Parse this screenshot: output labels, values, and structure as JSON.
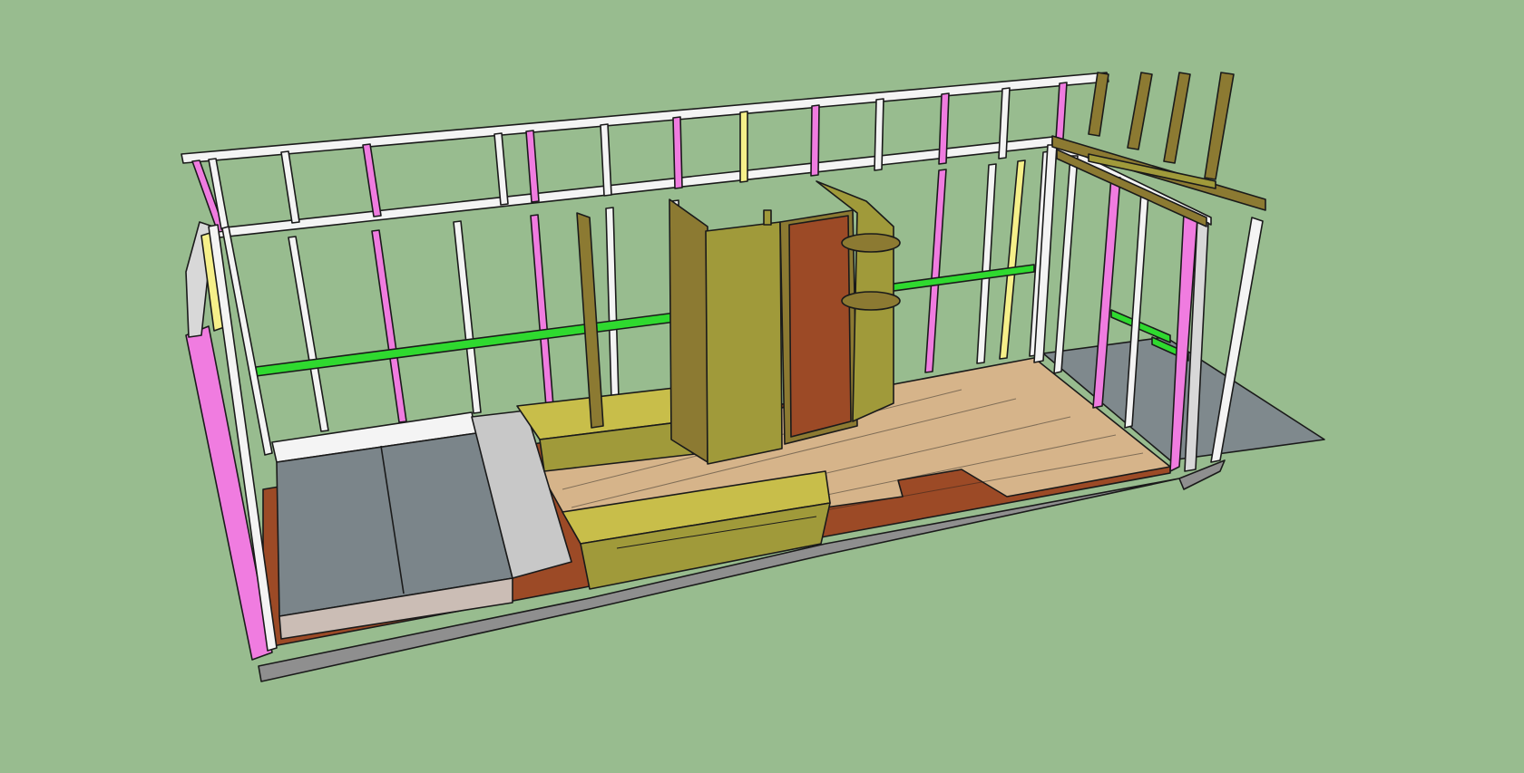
{
  "viewport": {
    "background": "#98bc8f",
    "icon": "3d-model-viewport"
  },
  "colors": {
    "stud_white": "#f4f4f4",
    "stud_pink": "#f07ce0",
    "stud_yellow": "#f6f08a",
    "blocking_green": "#2fd92f",
    "plywood": "#a09a3a",
    "plywood_light": "#c8be4a",
    "lumber": "#8c7a32",
    "floor_wood": "#d9b88c",
    "subfloor": "#9c4a26",
    "mattress": "#7b858a",
    "slab_grey": "#8a9296",
    "base_grey": "#9a9a9a"
  }
}
